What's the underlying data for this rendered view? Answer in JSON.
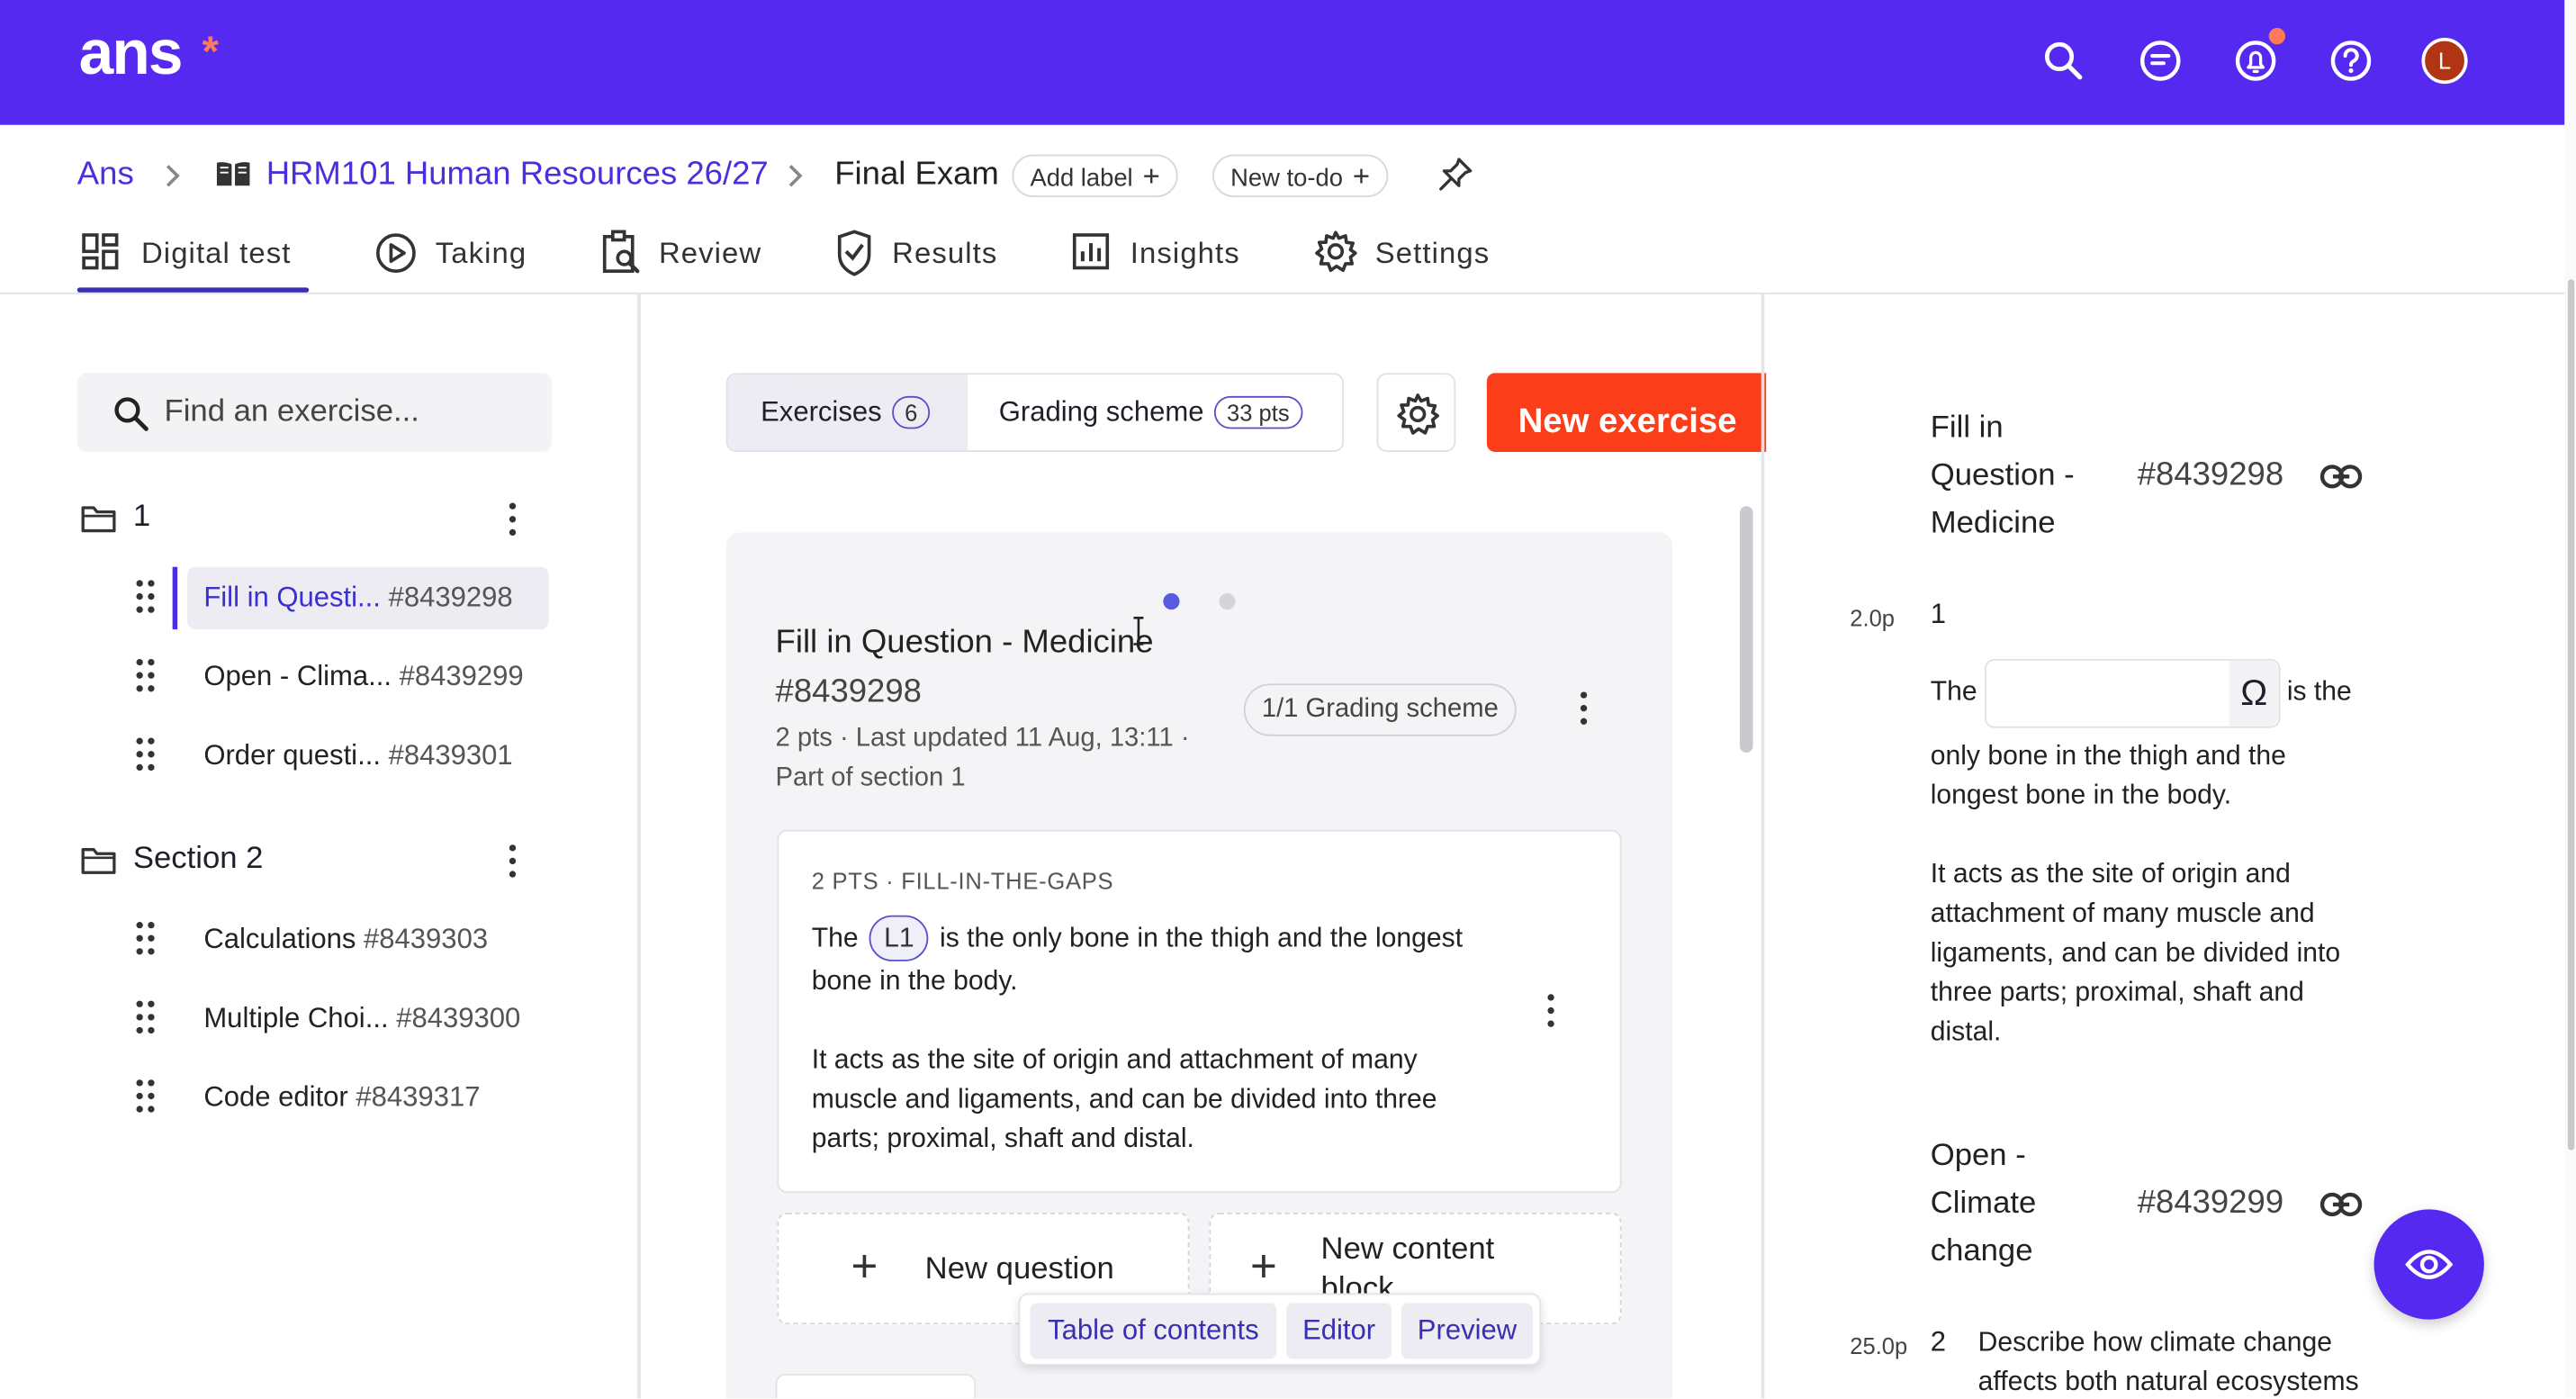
{
  "app": {
    "logo": "ans",
    "logo_mark": "*",
    "user_initial": "L"
  },
  "breadcrumb": {
    "root": "Ans",
    "course": "HRM101 Human Resources 26/27",
    "current": "Final Exam",
    "add_label": "Add label",
    "new_todo": "New to-do"
  },
  "tabs": [
    {
      "label": "Digital test",
      "icon": "dashboard-icon",
      "active": true
    },
    {
      "label": "Taking",
      "icon": "play-circle-icon"
    },
    {
      "label": "Review",
      "icon": "clipboard-search-icon"
    },
    {
      "label": "Results",
      "icon": "shield-check-icon"
    },
    {
      "label": "Insights",
      "icon": "bar-chart-icon"
    },
    {
      "label": "Settings",
      "icon": "gear-icon"
    }
  ],
  "sidebar": {
    "search_placeholder": "Find an exercise...",
    "sections": [
      {
        "name": "1",
        "exercises": [
          {
            "name": "Fill in Questi...",
            "id": "#8439298",
            "active": true
          },
          {
            "name": "Open - Clima...",
            "id": "#8439299"
          },
          {
            "name": "Order questi...",
            "id": "#8439301"
          }
        ]
      },
      {
        "name": "Section 2",
        "exercises": [
          {
            "name": "Calculations",
            "id": "#8439303"
          },
          {
            "name": "Multiple Choi...",
            "id": "#8439300"
          },
          {
            "name": "Code editor",
            "id": "#8439317"
          }
        ]
      }
    ]
  },
  "editor": {
    "exercises_label": "Exercises",
    "exercises_count": "6",
    "grading_label": "Grading scheme",
    "grading_points": "33 pts",
    "new_exercise": "New exercise",
    "exercise": {
      "title": "Fill in Question - Medicine",
      "id": "#8439298",
      "meta": "2 pts · Last updated 11 Aug, 13:11 ·",
      "section": "Part of section 1",
      "grading_pill": "1/1 Grading scheme"
    },
    "question": {
      "type": "2 PTS · FILL-IN-THE-GAPS",
      "text_before": "The",
      "gap": "L1",
      "text_after": "is the only bone in the thigh and the longest bone in the body.",
      "paragraph": "It acts as the site of origin and attachment of many muscle and ligaments, and can be divided into three parts; proximal, shaft and distal."
    },
    "new_question": "New question",
    "new_content_block": "New content block",
    "view_toggle": [
      "Table of contents",
      "Editor",
      "Preview"
    ]
  },
  "preview": {
    "items": [
      {
        "title": "Fill in Question - Medicine",
        "id": "#8439298",
        "points": "2.0p",
        "number": "1",
        "text_before": "The",
        "text_after_inline": "is the",
        "text_rest": "only bone in the thigh and the longest bone in the body.",
        "paragraph": "It acts as the site of origin and attachment of many muscle and ligaments, and can be divided into three parts; proximal, shaft and distal.",
        "omega": "Ω"
      },
      {
        "title": "Open - Climate change",
        "id": "#8439299",
        "points": "25.0p",
        "number": "2",
        "text": "Describe how climate change affects both natural ecosystems"
      }
    ]
  },
  "colors": {
    "brand": "#5629f0",
    "accent": "#fc3d19",
    "notification": "#ff7a59"
  }
}
